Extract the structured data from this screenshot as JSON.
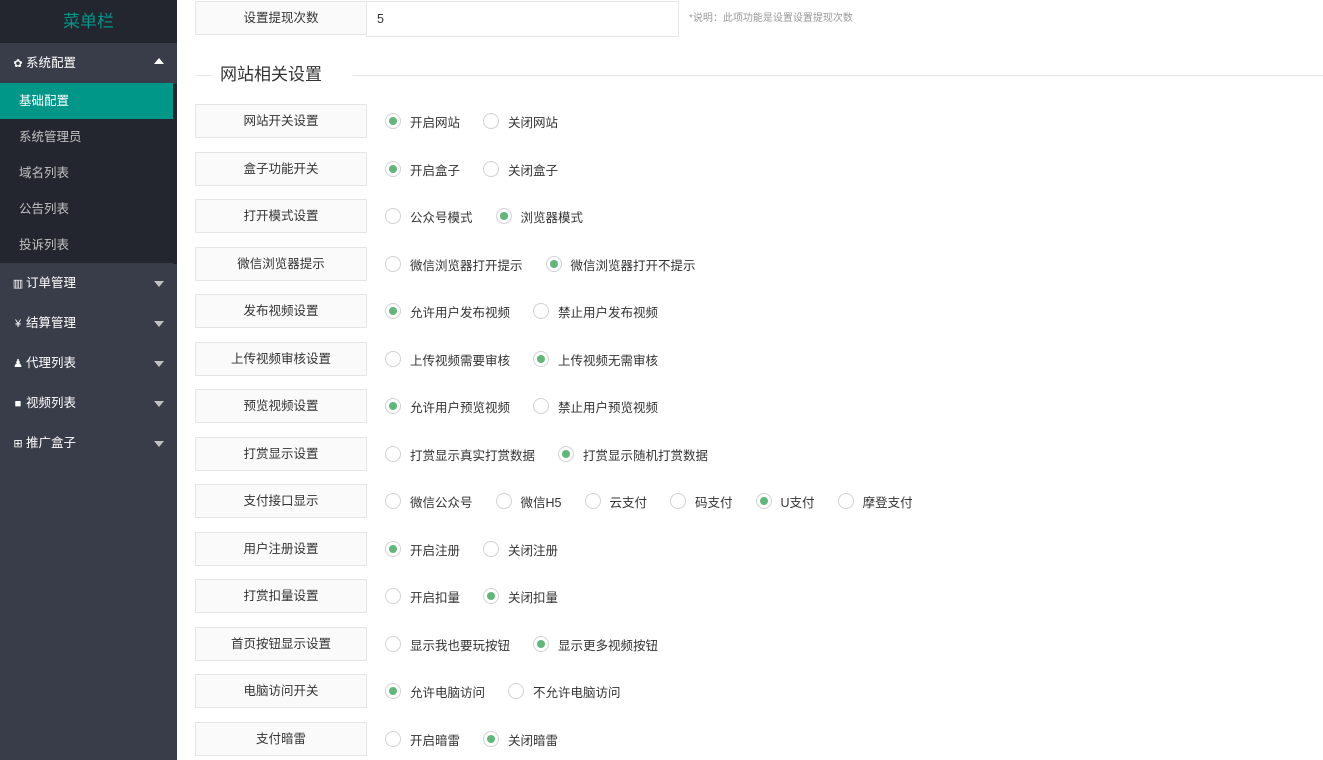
{
  "sidebar": {
    "title": "菜单栏",
    "groups": [
      {
        "icon": "gear-icon",
        "glyph": "✿",
        "label": "系统配置",
        "expanded": true
      },
      {
        "icon": "bar-chart-icon",
        "glyph": "▥",
        "label": "订单管理"
      },
      {
        "icon": "yen-icon",
        "glyph": "¥",
        "label": "结算管理"
      },
      {
        "icon": "user-icon",
        "glyph": "♟",
        "label": "代理列表"
      },
      {
        "icon": "video-icon",
        "glyph": "■",
        "label": "视频列表"
      },
      {
        "icon": "grid-icon",
        "glyph": "⊞",
        "label": "推广盒子"
      }
    ],
    "subitems": [
      "基础配置",
      "系统管理员",
      "域名列表",
      "公告列表",
      "投诉列表"
    ],
    "active_subitem": "基础配置"
  },
  "withdraw": {
    "label": "设置提现次数",
    "value": "5",
    "note": "*说明：此项功能是设置设置提现次数"
  },
  "section_title": "网站相关设置",
  "settings": [
    {
      "label": "网站开关设置",
      "options": [
        "开启网站",
        "关闭网站"
      ],
      "selected": 0
    },
    {
      "label": "盒子功能开关",
      "options": [
        "开启盒子",
        "关闭盒子"
      ],
      "selected": 0
    },
    {
      "label": "打开模式设置",
      "options": [
        "公众号模式",
        "浏览器模式"
      ],
      "selected": 1
    },
    {
      "label": "微信浏览器提示",
      "options": [
        "微信浏览器打开提示",
        "微信浏览器打开不提示"
      ],
      "selected": 1
    },
    {
      "label": "发布视频设置",
      "options": [
        "允许用户发布视频",
        "禁止用户发布视频"
      ],
      "selected": 0
    },
    {
      "label": "上传视频审核设置",
      "options": [
        "上传视频需要审核",
        "上传视频无需审核"
      ],
      "selected": 1
    },
    {
      "label": "预览视频设置",
      "options": [
        "允许用户预览视频",
        "禁止用户预览视频"
      ],
      "selected": 0
    },
    {
      "label": "打赏显示设置",
      "options": [
        "打赏显示真实打赏数据",
        "打赏显示随机打赏数据"
      ],
      "selected": 1
    },
    {
      "label": "支付接口显示",
      "options": [
        "微信公众号",
        "微信H5",
        "云支付",
        "码支付",
        "U支付",
        "摩登支付"
      ],
      "selected": 4
    },
    {
      "label": "用户注册设置",
      "options": [
        "开启注册",
        "关闭注册"
      ],
      "selected": 0
    },
    {
      "label": "打赏扣量设置",
      "options": [
        "开启扣量",
        "关闭扣量"
      ],
      "selected": 1
    },
    {
      "label": "首页按钮显示设置",
      "options": [
        "显示我也要玩按钮",
        "显示更多视频按钮"
      ],
      "selected": 1
    },
    {
      "label": "电脑访问开关",
      "options": [
        "允许电脑访问",
        "不允许电脑访问"
      ],
      "selected": 0
    },
    {
      "label": "支付暗雷",
      "options": [
        "开启暗雷",
        "关闭暗雷"
      ],
      "selected": 1
    }
  ],
  "colors": {
    "sidebar_bg": "#393d49",
    "sidebar_dark": "#23262e",
    "accent": "#009688",
    "radio_checked": "#5fb878"
  }
}
